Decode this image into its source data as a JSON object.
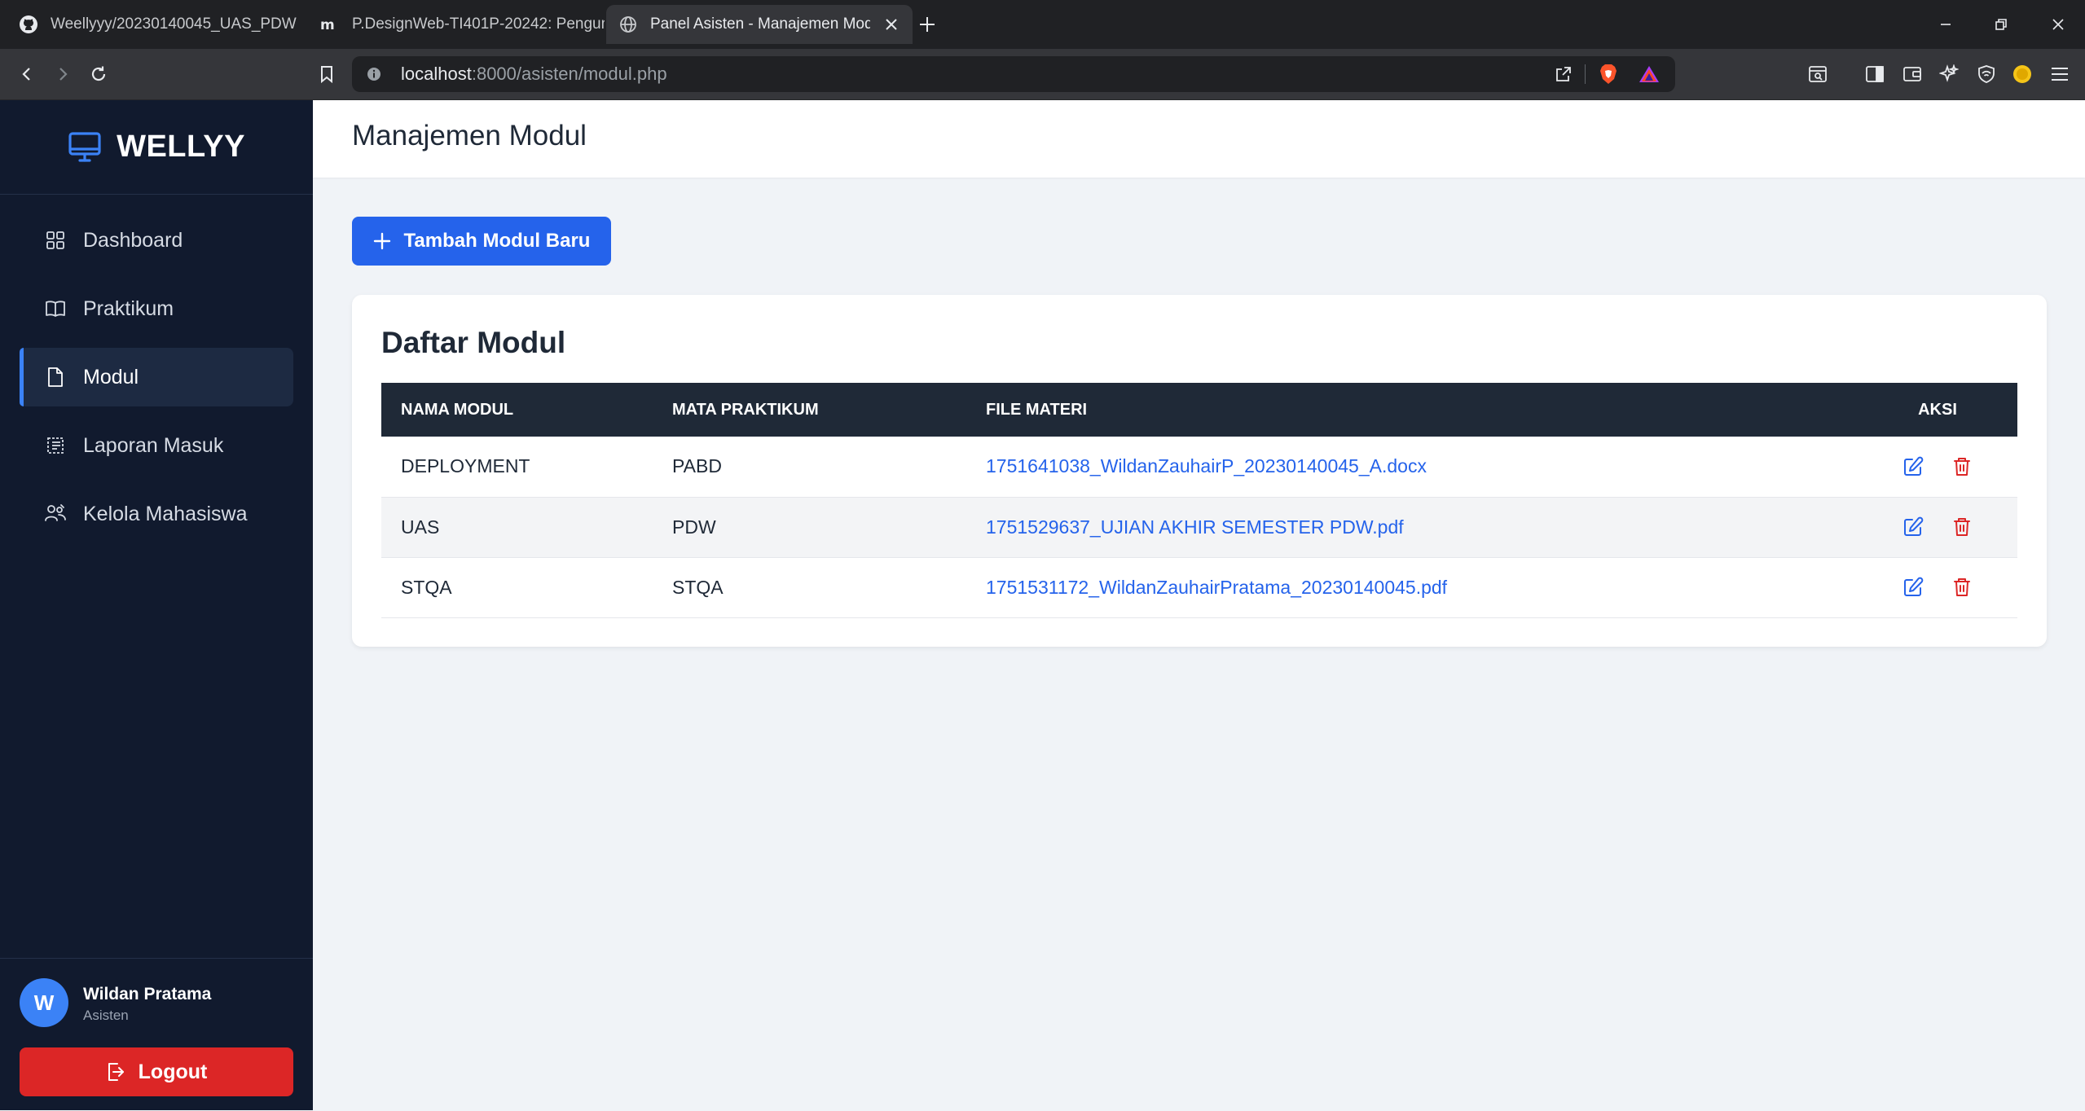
{
  "browser": {
    "tabs": [
      {
        "title": "Weellyyy/20230140045_UAS_PDW",
        "favicon": "github-icon"
      },
      {
        "title": "P.DesignWeb-TI401P-20242: Pengum",
        "favicon": "moodle-icon"
      },
      {
        "title": "Panel Asisten - Manajemen Mod",
        "favicon": "globe-icon",
        "active": true
      }
    ],
    "url_host": "localhost",
    "url_rest": ":8000/asisten/modul.php"
  },
  "sidebar": {
    "brand": "WELLYY",
    "items": [
      {
        "label": "Dashboard",
        "icon": "grid-icon"
      },
      {
        "label": "Praktikum",
        "icon": "book-icon"
      },
      {
        "label": "Modul",
        "icon": "document-icon",
        "active": true
      },
      {
        "label": "Laporan Masuk",
        "icon": "report-icon"
      },
      {
        "label": "Kelola Mahasiswa",
        "icon": "users-icon"
      }
    ],
    "user": {
      "initial": "W",
      "name": "Wildan Pratama",
      "role": "Asisten"
    },
    "logout_label": "Logout"
  },
  "header": {
    "title": "Manajemen Modul"
  },
  "main": {
    "add_button": "Tambah Modul Baru",
    "card_title": "Daftar Modul",
    "table": {
      "headers": [
        "NAMA MODUL",
        "MATA PRAKTIKUM",
        "FILE MATERI",
        "AKSI"
      ],
      "rows": [
        {
          "nama": "DEPLOYMENT",
          "mata": "PABD",
          "file": "1751641038_WildanZauhairP_20230140045_A.docx"
        },
        {
          "nama": "UAS",
          "mata": "PDW",
          "file": "1751529637_UJIAN AKHIR SEMESTER PDW.pdf"
        },
        {
          "nama": "STQA",
          "mata": "STQA",
          "file": "1751531172_WildanZauhairPratama_20230140045.pdf"
        }
      ]
    }
  },
  "colors": {
    "sidebar_bg": "#111a2e",
    "accent": "#2563eb",
    "danger": "#dc2626",
    "table_header": "#1f2937"
  }
}
